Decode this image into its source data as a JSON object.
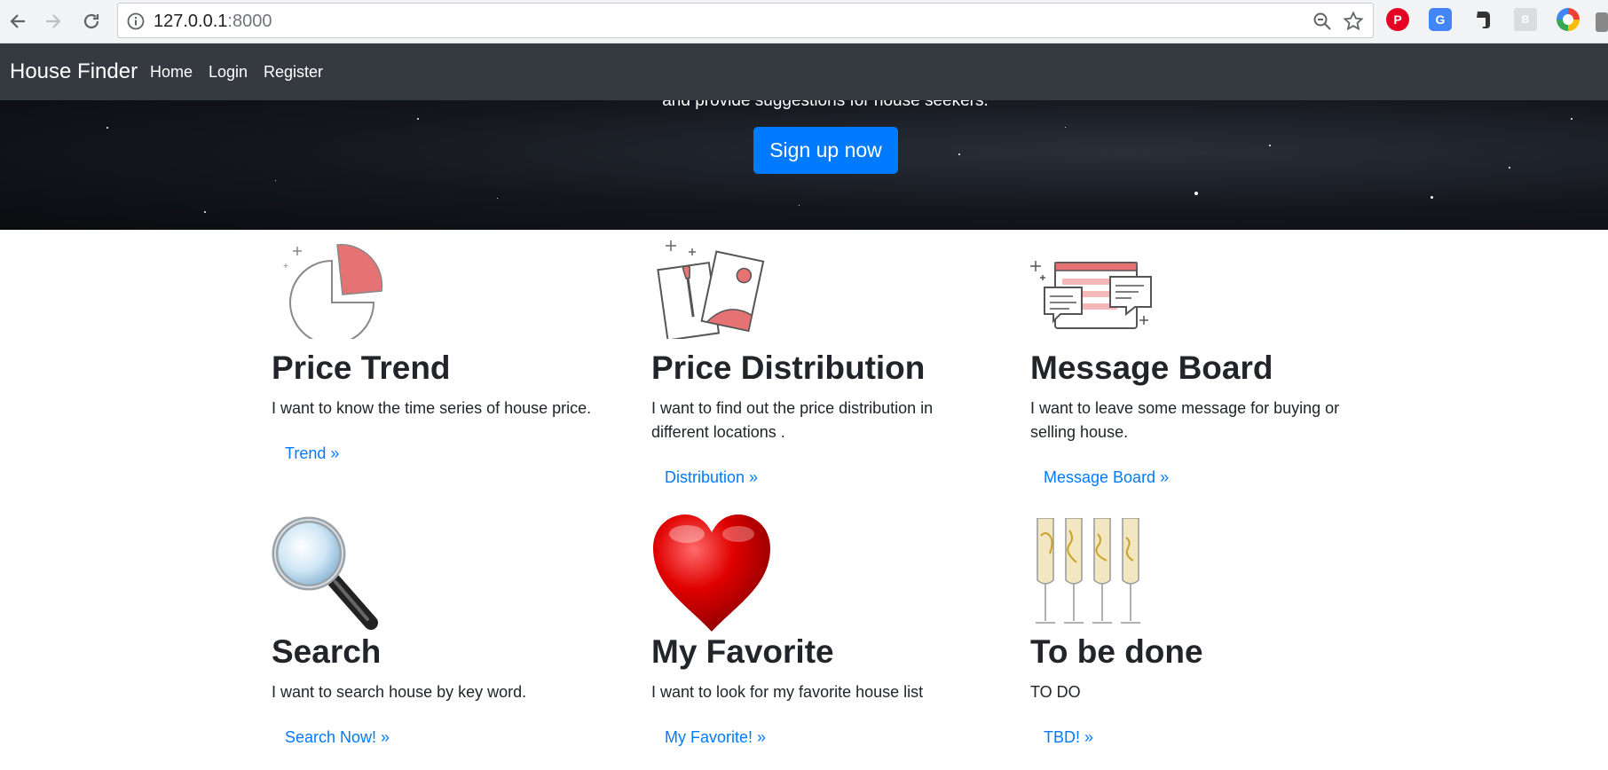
{
  "browser": {
    "url_host": "127.0.0.1",
    "url_port": ":8000",
    "icons": [
      "back-icon",
      "forward-icon",
      "reload-icon",
      "info-icon",
      "zoom-icon",
      "star-icon"
    ],
    "extensions": [
      "pinterest-extension-icon",
      "translate-extension-icon",
      "evernote-extension-icon",
      "reader-extension-icon",
      "chrome-extension-icon"
    ]
  },
  "navbar": {
    "brand": "House Finder",
    "links": [
      "Home",
      "Login",
      "Register"
    ]
  },
  "hero": {
    "text": "and provide suggestions for house seekers.",
    "button": "Sign up now",
    "button_color": "#007bff"
  },
  "features": [
    {
      "title": "Price Trend",
      "description": "I want to know the time series of house price.",
      "link": "Trend »",
      "icon": "pie-chart-icon"
    },
    {
      "title": "Price Distribution",
      "description": "I want to find out the price distribution in different locations .",
      "link": "Distribution »",
      "icon": "paint-canvas-icon"
    },
    {
      "title": "Message Board",
      "description": "I want to leave some message for buying or selling house.",
      "link": "Message Board »",
      "icon": "chat-window-icon"
    },
    {
      "title": "Search",
      "description": "I want to search house by key word.",
      "link": "Search Now! »",
      "icon": "magnifier-icon"
    },
    {
      "title": "My Favorite",
      "description": "I want to look for my favorite house list",
      "link": "My Favorite! »",
      "icon": "heart-icon"
    },
    {
      "title": "To be done",
      "description": "TO DO",
      "link": "TBD! »",
      "icon": "champagne-glasses-icon"
    }
  ],
  "colors": {
    "navbar": "#343a40",
    "link": "#007bff",
    "accent": "#e57373"
  }
}
